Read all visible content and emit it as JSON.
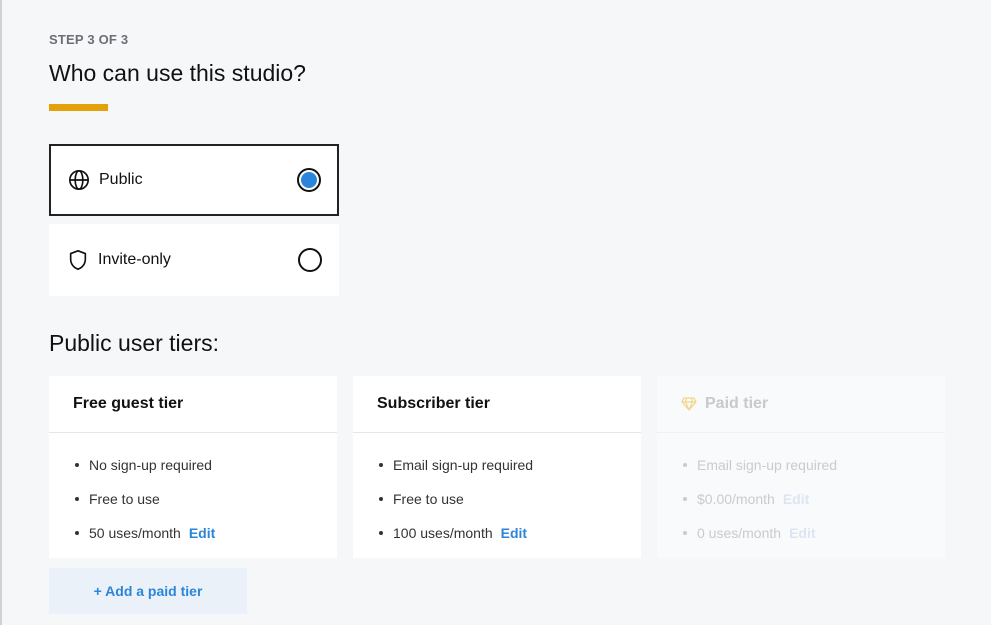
{
  "header": {
    "step": "STEP 3 OF 3",
    "title": "Who can use this studio?",
    "accent_color": "#e3a10b"
  },
  "visibility_options": [
    {
      "label": "Public",
      "icon": "globe-icon",
      "selected": true
    },
    {
      "label": "Invite-only",
      "icon": "shield-icon",
      "selected": false
    }
  ],
  "tiers_section": {
    "title": "Public user tiers:",
    "tiers": [
      {
        "name": "Free guest tier",
        "items": [
          "No sign-up required",
          "Free to use",
          "50 uses/month"
        ],
        "edit_label": "Edit"
      },
      {
        "name": "Subscriber tier",
        "items": [
          "Email sign-up required",
          "Free to use",
          "100 uses/month"
        ],
        "edit_label": "Edit"
      },
      {
        "name": "Paid tier",
        "icon": "diamond-icon",
        "disabled": true,
        "items": [
          "Email sign-up required",
          "$0.00/month",
          "0 uses/month"
        ],
        "edit_label": "Edit"
      }
    ],
    "add_button": "+ Add a paid tier"
  },
  "colors": {
    "link": "#2b86d9",
    "radio_selected": "#2b86d9",
    "background": "#f6f7f9"
  }
}
